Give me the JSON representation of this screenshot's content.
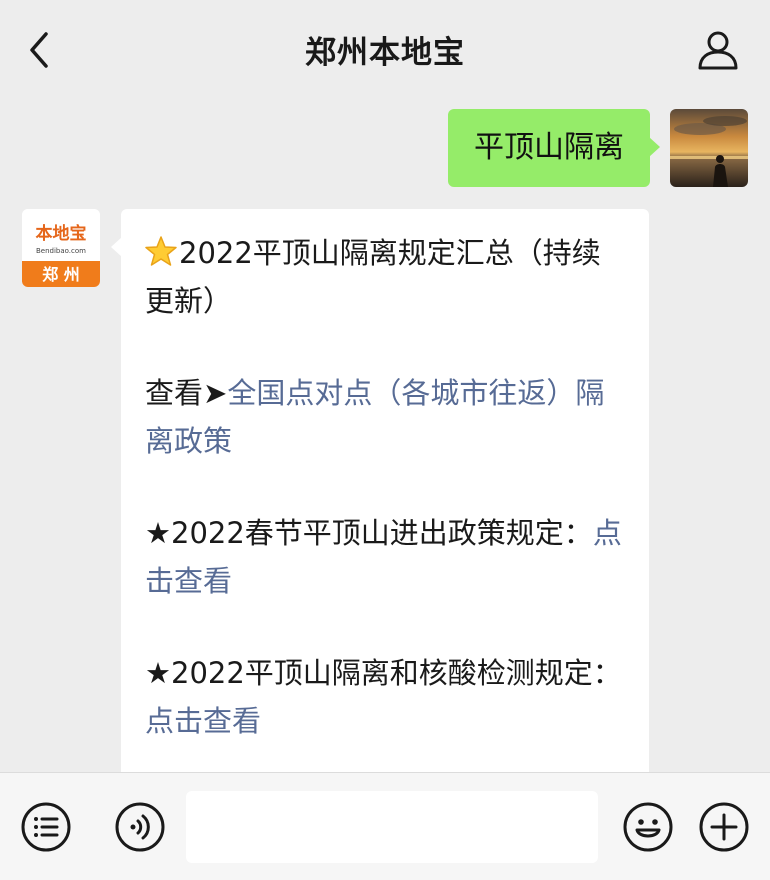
{
  "header": {
    "title": "郑州本地宝",
    "back_icon": "chevron-left-icon",
    "profile_icon": "person-icon"
  },
  "my_message": {
    "text": "平顶山隔离"
  },
  "bot_avatar": {
    "logo_text": "本地宝",
    "logo_sub": "Bendibao.com",
    "city": "郑州",
    "accent": "#f07c1b"
  },
  "bot_message": {
    "p1_text": "2022平顶山隔离规定汇总（持续更新）",
    "p2_prefix": "查看➤",
    "p2_link": "全国点对点（各城市往返）隔离政策",
    "p3_text": "★2022春节平顶山进出政策规定：",
    "p3_link": "点击查看",
    "p4_text": "★2022平顶山隔离和核酸检测规定：",
    "p4_link": "点击查看"
  },
  "toolbar": {
    "input_placeholder": "",
    "list_icon": "list-icon",
    "voice_icon": "voice-icon",
    "emoji_icon": "emoji-icon",
    "plus_icon": "plus-icon"
  },
  "colors": {
    "bubble_green": "#95ec69",
    "link_blue": "#576b95",
    "background": "#ededed"
  }
}
